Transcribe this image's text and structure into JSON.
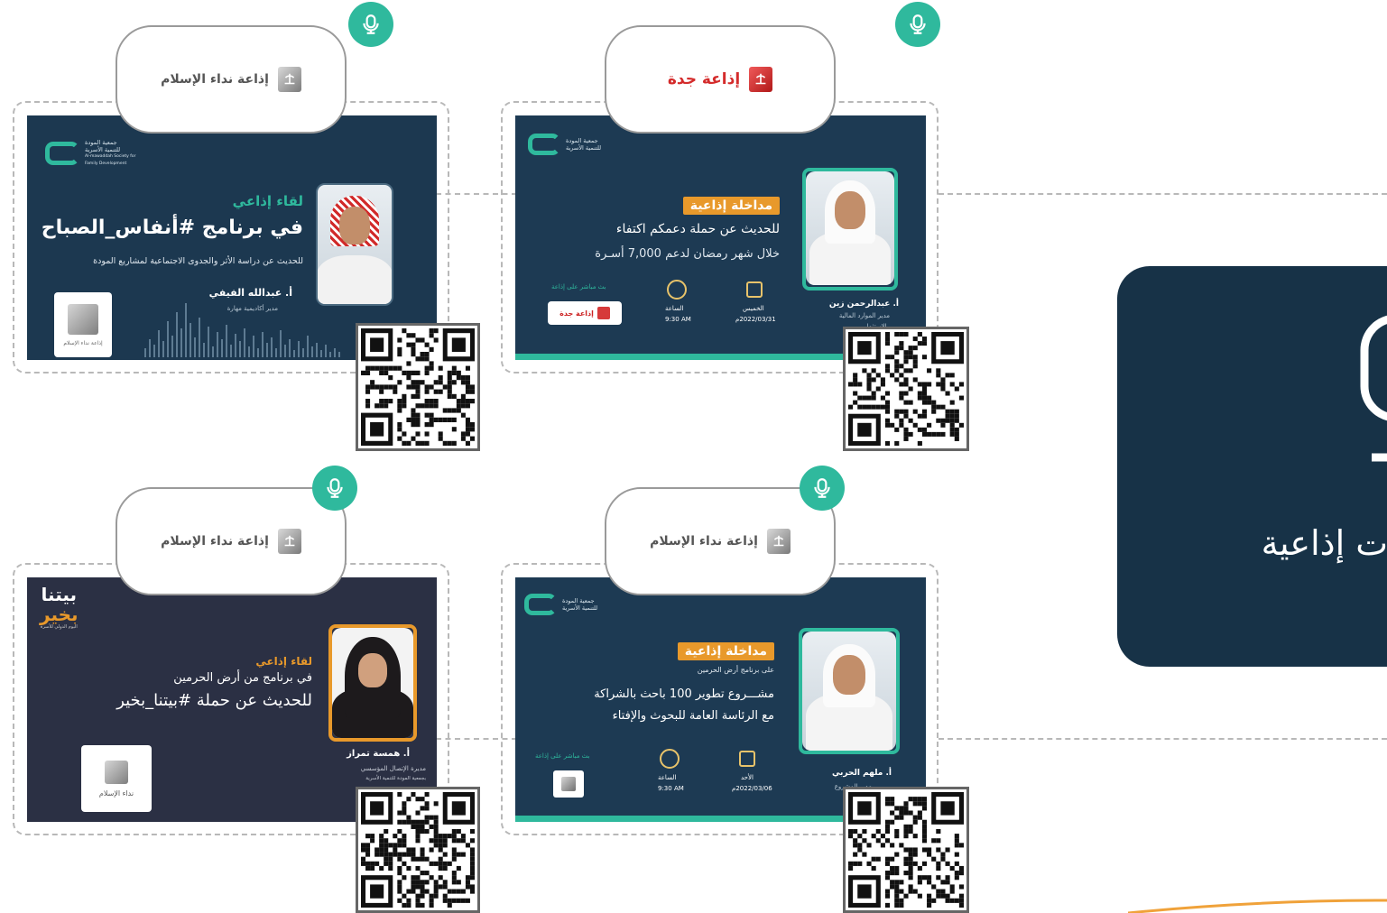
{
  "side_panel": {
    "title": "ت إذاعية"
  },
  "cards": [
    {
      "station": "إذاعة نداء الإسلام",
      "org": {
        "line1": "جمعية المودة",
        "line2": "للتنمية الأسرية",
        "line3": "Al-mawaddah Society for",
        "line4": "Family Development"
      },
      "heading": "لقاء إذاعي",
      "title": "في برنامج #أنفاس_الصباح",
      "subtitle": "للحديث عن دراسة الأثر والجدوى الاجتماعية لمشاريع المودة",
      "speaker": "أ. عبدالله الفيفي",
      "role": "مدير أكاديمية مهارة",
      "logo_caption": "إذاعة نداء الإسلام"
    },
    {
      "station": "إذاعة جدة",
      "org": {
        "line1": "جمعية المودة",
        "line2": "للتنمية الأسرية"
      },
      "heading": "مداخلة إذاعية",
      "title": "للحديث عن حملة دعمكم اكتفاء",
      "subtitle": "خلال شهر رمضان لدعم 7,000 أسـرة",
      "speaker": "أ. عبدالرحمن زين",
      "role": "مدير الموارد المالية",
      "role2": "والاستثمار",
      "day_label": "الخميس",
      "date": "2022/03/31م",
      "time_label": "الساعة",
      "time": "9:30 AM",
      "live_label": "بث مباشر على إذاعة",
      "live_btn": "إذاعة جدة"
    },
    {
      "station": "إذاعة نداء الإسلام",
      "brand": {
        "line1": "بيتنا",
        "line2": "بخير",
        "line3": "اليوم الدولي للأسرة"
      },
      "heading": "لقاء إذاعي",
      "title": "في برنامج من أرض الحرمين",
      "subtitle": "للحديث عن حملة #بيتنا_بخير",
      "speaker": "أ. همسة تمراز",
      "role": "مديرة الإتصال المؤسسي",
      "role2": "بجمعية المودة للتنمية الأسرية",
      "logo_caption": "نداء الإسلام"
    },
    {
      "station": "إذاعة نداء الإسلام",
      "org": {
        "line1": "جمعية المودة",
        "line2": "للتنمية الأسرية"
      },
      "heading": "مداخلة إذاعية",
      "program": "على برنامج أرض الحرمين",
      "title": "مشـــروع تطوير 100 باحث بالشراكة",
      "subtitle": "مع الرئاسة العامة للبحوث والإفتاء",
      "speaker": "أ. ملهم الحربي",
      "role": "مدير المشروع",
      "day_label": "الأحد",
      "date": "2022/03/06م",
      "time_label": "الساعة",
      "time": "9:30 AM",
      "live_label": "بث مباشر على إذاعة"
    }
  ],
  "icons": {
    "mic": "microphone-icon",
    "qr": "qr-code"
  },
  "colors": {
    "teal": "#2fb99d",
    "navy": "#173247",
    "orange": "#e8992b",
    "card_dark": "#1e3a52"
  }
}
